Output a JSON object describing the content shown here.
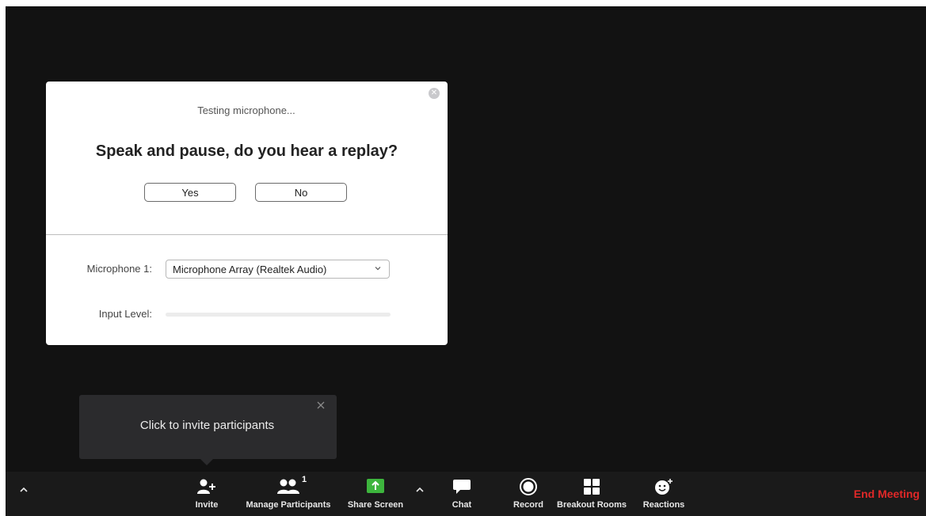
{
  "dialog": {
    "testing_text": "Testing microphone...",
    "question": "Speak and pause, do you hear a replay?",
    "yes_label": "Yes",
    "no_label": "No",
    "microphone_label": "Microphone 1:",
    "microphone_value": "Microphone Array (Realtek Audio)",
    "input_level_label": "Input Level:",
    "input_level": 0
  },
  "tooltip": {
    "text": "Click to invite participants"
  },
  "toolbar": {
    "invite_label": "Invite",
    "manage_participants_label": "Manage Participants",
    "participant_count": "1",
    "share_screen_label": "Share Screen",
    "chat_label": "Chat",
    "record_label": "Record",
    "breakout_rooms_label": "Breakout Rooms",
    "reactions_label": "Reactions",
    "end_meeting_label": "End Meeting"
  },
  "colors": {
    "video_background": "#121212",
    "toolbar_background": "#1a1a1a",
    "share_screen_green": "#3db53d",
    "end_meeting_red": "#e02828"
  }
}
